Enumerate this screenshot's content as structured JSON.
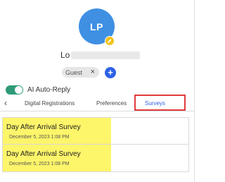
{
  "profile": {
    "initials": "LP",
    "name_visible": "Lo",
    "guest_label": "Guest",
    "remove_glyph": "×",
    "add_glyph": "+",
    "edit_icon": "pencil-icon"
  },
  "ai_reply": {
    "label": "AI Auto-Reply",
    "enabled": true
  },
  "tabs": {
    "back_glyph": "‹",
    "items": [
      {
        "label": "Digital Registrations"
      },
      {
        "label": "Preferences"
      },
      {
        "label": "Surveys",
        "active": true
      }
    ]
  },
  "surveys": [
    {
      "title": "Day After Arrival Survey",
      "date": "December 5, 2023 1:08 PM"
    },
    {
      "title": "Day After Arrival Survey",
      "date": "December 5, 2023 1:08 PM"
    }
  ],
  "colors": {
    "avatar": "#3f8fe3",
    "accent": "#2e62e8",
    "toggle_on": "#2e9a78",
    "highlight": "#fdf56a",
    "annotation_box": "#e03c3c",
    "edit_badge": "#f2c21b"
  }
}
